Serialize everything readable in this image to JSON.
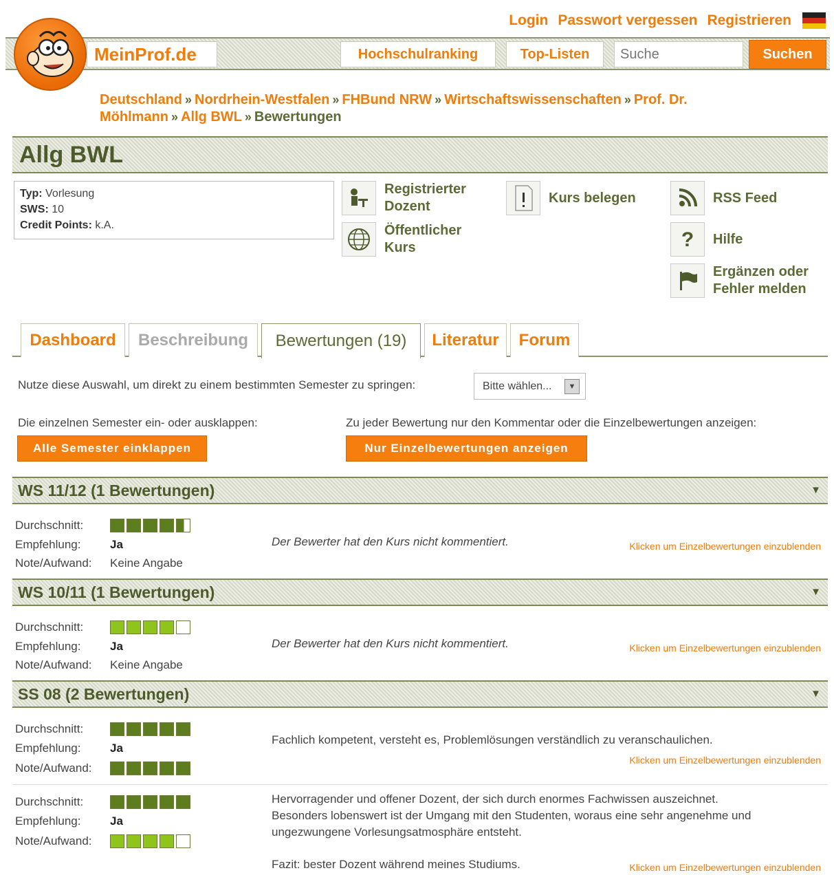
{
  "toplinks": {
    "login": "Login",
    "password": "Passwort vergessen",
    "register": "Registrieren"
  },
  "header": {
    "brand": "MeinProf.de",
    "nav": [
      "Hochschulranking",
      "Top-Listen"
    ],
    "search_placeholder": "Suche",
    "search_button": "Suchen"
  },
  "breadcrumb": {
    "items": [
      "Deutschland",
      "Nordrhein-Westfalen",
      "FHBund NRW",
      "Wirtschaftswissenschaften",
      "Prof. Dr. Möhlmann",
      "Allg BWL"
    ],
    "current": "Bewertungen",
    "separator": "»"
  },
  "course": {
    "title": "Allg BWL",
    "typ_label": "Typ:",
    "typ": "Vorlesung",
    "sws_label": "SWS:",
    "sws": "10",
    "cp_label": "Credit Points:",
    "cp": "k.A."
  },
  "actions": {
    "registered": "Registrierter Dozent",
    "public": "Öffentlicher Kurs",
    "enroll": "Kurs belegen",
    "rss": "RSS Feed",
    "help": "Hilfe",
    "report": "Ergänzen oder Fehler melden"
  },
  "tabs": [
    "Dashboard",
    "Beschreibung",
    "Bewertungen (19)",
    "Literatur",
    "Forum"
  ],
  "controls": {
    "jump_label": "Nutze diese Auswahl, um direkt zu einem bestimmten Semester zu springen:",
    "select_value": "Bitte wählen...",
    "collapse_label": "Die einzelnen Semester ein- oder ausklappen:",
    "collapse_button": "Alle Semester einklappen",
    "toggle_label": "Zu jeder Bewertung nur den Kommentar oder die Einzelbewertungen anzeigen:",
    "toggle_button": "Nur Einzelbewertungen anzeigen"
  },
  "labels": {
    "avg": "Durchschnitt:",
    "rec": "Empfehlung:",
    "grade": "Note/Aufwand:",
    "details": "Klicken um Einzelbewertungen einzublenden",
    "no_comment": "Der Bewerter hat den Kurs nicht kommentiert."
  },
  "semesters": [
    {
      "title": "WS 11/12 (1 Bewertungen)",
      "reviews": [
        {
          "avg_stars": 4.5,
          "recommendation": "Ja",
          "grade": "Keine Angabe"
        }
      ]
    },
    {
      "title": "WS 10/11 (1 Bewertungen)",
      "reviews": [
        {
          "avg_stars": 4,
          "recommendation": "Ja",
          "grade": "Keine Angabe"
        }
      ]
    },
    {
      "title": "SS 08 (2 Bewertungen)",
      "reviews": [
        {
          "avg_stars": 5,
          "recommendation": "Ja",
          "grade_stars": 5,
          "comment": "Fachlich kompetent, versteht es, Problemlösungen verständlich zu veranschaulichen."
        },
        {
          "avg_stars": 5,
          "recommendation": "Ja",
          "grade_stars": 4,
          "comment_lines": [
            "Hervorragender und offener Dozent, der sich durch enormes Fachwissen auszeichnet.",
            "Besonders lobenswert ist der Umgang mit den Studenten, woraus eine sehr angenehme und",
            "ungezwungene Vorlesungsatmosphäre entsteht.",
            "Fazit: bester Dozent während meines Studiums."
          ]
        }
      ]
    }
  ],
  "colors": {
    "accent": "#f07c0a",
    "green": "#5a6b35",
    "star_dark": "#5d7d1f",
    "star_light": "#8fc41c"
  }
}
